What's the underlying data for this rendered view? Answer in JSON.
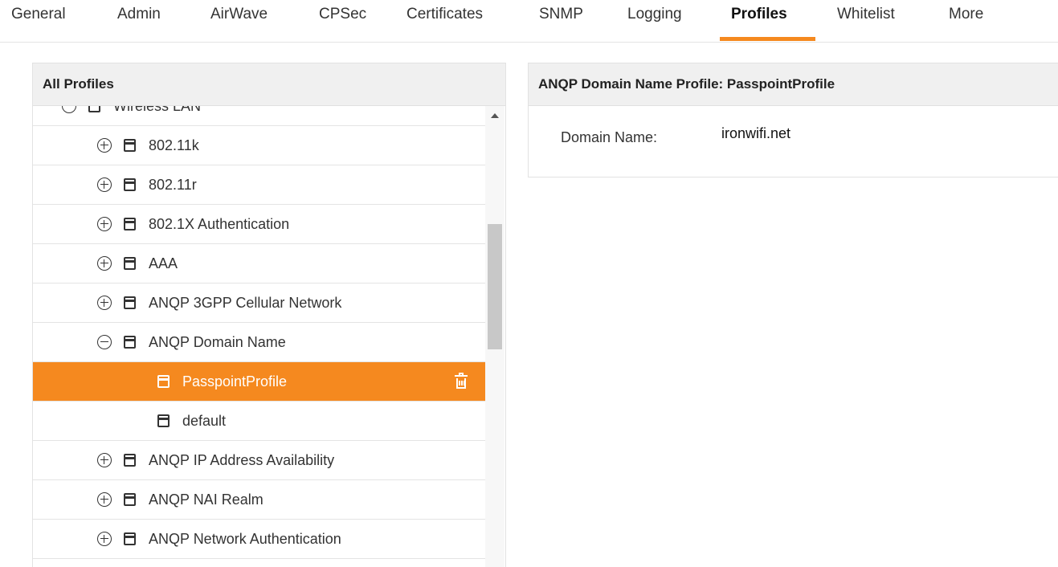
{
  "tabs": [
    {
      "label": "General"
    },
    {
      "label": "Admin"
    },
    {
      "label": "AirWave"
    },
    {
      "label": "CPSec"
    },
    {
      "label": "Certificates"
    },
    {
      "label": "SNMP"
    },
    {
      "label": "Logging"
    },
    {
      "label": "Profiles",
      "active": true
    },
    {
      "label": "Whitelist"
    },
    {
      "label": "More"
    }
  ],
  "accent_color": "#f5891f",
  "left_panel": {
    "title": "All Profiles",
    "tree": [
      {
        "label": "Wireless LAN",
        "expander": "minus",
        "level": 0
      },
      {
        "label": "802.11k",
        "expander": "plus",
        "level": 1
      },
      {
        "label": "802.11r",
        "expander": "plus",
        "level": 1
      },
      {
        "label": "802.1X Authentication",
        "expander": "plus",
        "level": 1
      },
      {
        "label": "AAA",
        "expander": "plus",
        "level": 1
      },
      {
        "label": "ANQP 3GPP Cellular Network",
        "expander": "plus",
        "level": 1
      },
      {
        "label": "ANQP Domain Name",
        "expander": "minus",
        "level": 1
      },
      {
        "label": "PasspointProfile",
        "expander": "none",
        "level": 2,
        "selected": true,
        "icon_right": "trash-icon"
      },
      {
        "label": "default",
        "expander": "none",
        "level": 2
      },
      {
        "label": "ANQP IP Address Availability",
        "expander": "plus",
        "level": 1
      },
      {
        "label": "ANQP NAI Realm",
        "expander": "plus",
        "level": 1
      },
      {
        "label": "ANQP Network Authentication",
        "expander": "plus",
        "level": 1
      }
    ]
  },
  "right_panel": {
    "title": "ANQP Domain Name Profile: PasspointProfile",
    "field_label": "Domain Name:",
    "field_value": "ironwifi.net"
  }
}
